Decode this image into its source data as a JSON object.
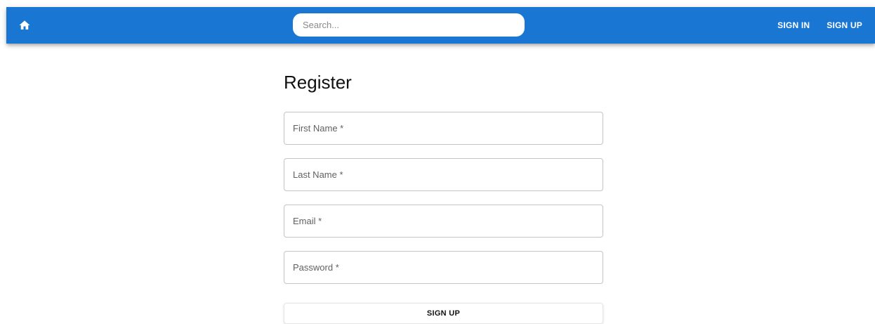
{
  "appbar": {
    "color": "#1976d2",
    "home_icon": "home-icon",
    "search": {
      "placeholder": "Search...",
      "value": ""
    },
    "links": {
      "sign_in": "SIGN IN",
      "sign_up": "SIGN UP"
    }
  },
  "form": {
    "title": "Register",
    "fields": [
      {
        "label": "First Name *"
      },
      {
        "label": "Last Name *"
      },
      {
        "label": "Email *"
      },
      {
        "label": "Password *"
      }
    ],
    "submit_label": "SIGN UP"
  }
}
